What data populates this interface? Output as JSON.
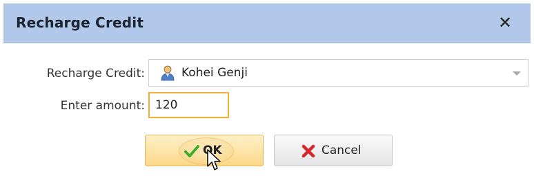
{
  "dialog": {
    "title": "Recharge Credit",
    "close_glyph": "✕"
  },
  "form": {
    "recharge_label": "Recharge Credit:",
    "recharge_value": "Kohei Genji",
    "recharge_icon": "user-icon",
    "amount_label": "Enter amount:",
    "amount_value": "120"
  },
  "buttons": {
    "ok_label": "OK",
    "ok_icon": "checkmark-icon",
    "cancel_label": "Cancel",
    "cancel_icon": "x-mark-icon"
  },
  "colors": {
    "titlebar": "#b1c8ea",
    "ok_button": "#fbd88a",
    "focus_border": "#f2ad39",
    "check_green": "#3fae2a",
    "cancel_red": "#d7262b"
  }
}
